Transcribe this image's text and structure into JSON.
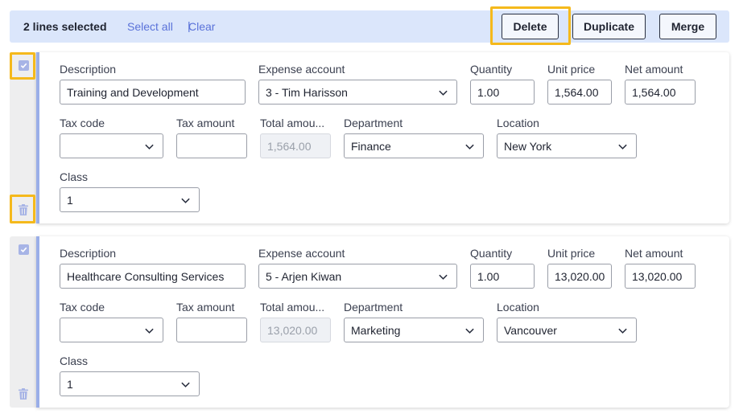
{
  "toolbar": {
    "selected_text": "2 lines selected",
    "select_all": "Select all",
    "separator": "|",
    "clear": "Clear",
    "delete": "Delete",
    "duplicate": "Duplicate",
    "merge": "Merge"
  },
  "labels": {
    "description": "Description",
    "expense_account": "Expense account",
    "quantity": "Quantity",
    "unit_price": "Unit price",
    "net_amount": "Net amount",
    "tax_code": "Tax code",
    "tax_amount": "Tax amount",
    "total_amount": "Total amou...",
    "department": "Department",
    "location": "Location",
    "class": "Class"
  },
  "lines": [
    {
      "description": "Training and Development",
      "expense_account": "3 - Tim Harisson",
      "quantity": "1.00",
      "unit_price": "1,564.00",
      "net_amount": "1,564.00",
      "tax_code": "",
      "tax_amount": "",
      "total_amount": "1,564.00",
      "department": "Finance",
      "location": "New York",
      "class": "1"
    },
    {
      "description": "Healthcare Consulting Services",
      "expense_account": "5 - Arjen Kiwan",
      "quantity": "1.00",
      "unit_price": "13,020.00",
      "net_amount": "13,020.00",
      "tax_code": "",
      "tax_amount": "",
      "total_amount": "13,020.00",
      "department": "Marketing",
      "location": "Vancouver",
      "class": "1"
    }
  ],
  "colors": {
    "accent": "#5a72d9",
    "highlight": "#f5b91c",
    "toolbar_bg": "#dbe6fb"
  }
}
